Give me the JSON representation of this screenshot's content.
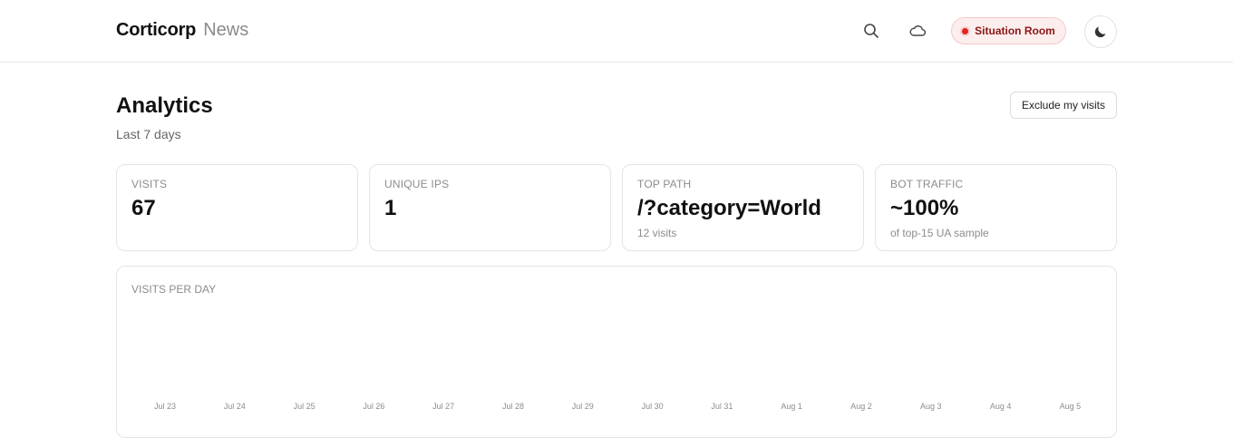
{
  "header": {
    "brand_name": "Corticorp",
    "brand_sub": "News",
    "situation_label": "Situation Room",
    "icons": [
      "search-icon",
      "cloud-icon",
      "moon-icon"
    ]
  },
  "page": {
    "title": "Analytics",
    "subtitle": "Last 7 days",
    "exclude_label": "Exclude my visits"
  },
  "stats": [
    {
      "label": "VISITS",
      "value": "67",
      "note": ""
    },
    {
      "label": "UNIQUE IPS",
      "value": "1",
      "note": ""
    },
    {
      "label": "TOP PATH",
      "value": "/?category=World",
      "note": "12 visits"
    },
    {
      "label": "BOT TRAFFIC",
      "value": "~100%",
      "note": "of top-15 UA sample"
    }
  ],
  "chart_data": {
    "type": "bar",
    "title": "VISITS PER DAY",
    "categories": [
      "Jul 23",
      "Jul 24",
      "Jul 25",
      "Jul 26",
      "Jul 27",
      "Jul 28",
      "Jul 29",
      "Jul 30",
      "Jul 31",
      "Aug 1",
      "Aug 2",
      "Aug 3",
      "Aug 4",
      "Aug 5"
    ],
    "values": [
      0,
      0,
      0,
      0,
      0,
      0,
      0,
      0,
      0,
      0,
      0,
      0,
      0,
      0
    ],
    "xlabel": "",
    "ylabel": "",
    "bar_color": "#111111"
  },
  "colors": {
    "accent_red": "#e02424",
    "situation_bg": "#fdeeee",
    "muted_text": "#8c8c8c"
  }
}
